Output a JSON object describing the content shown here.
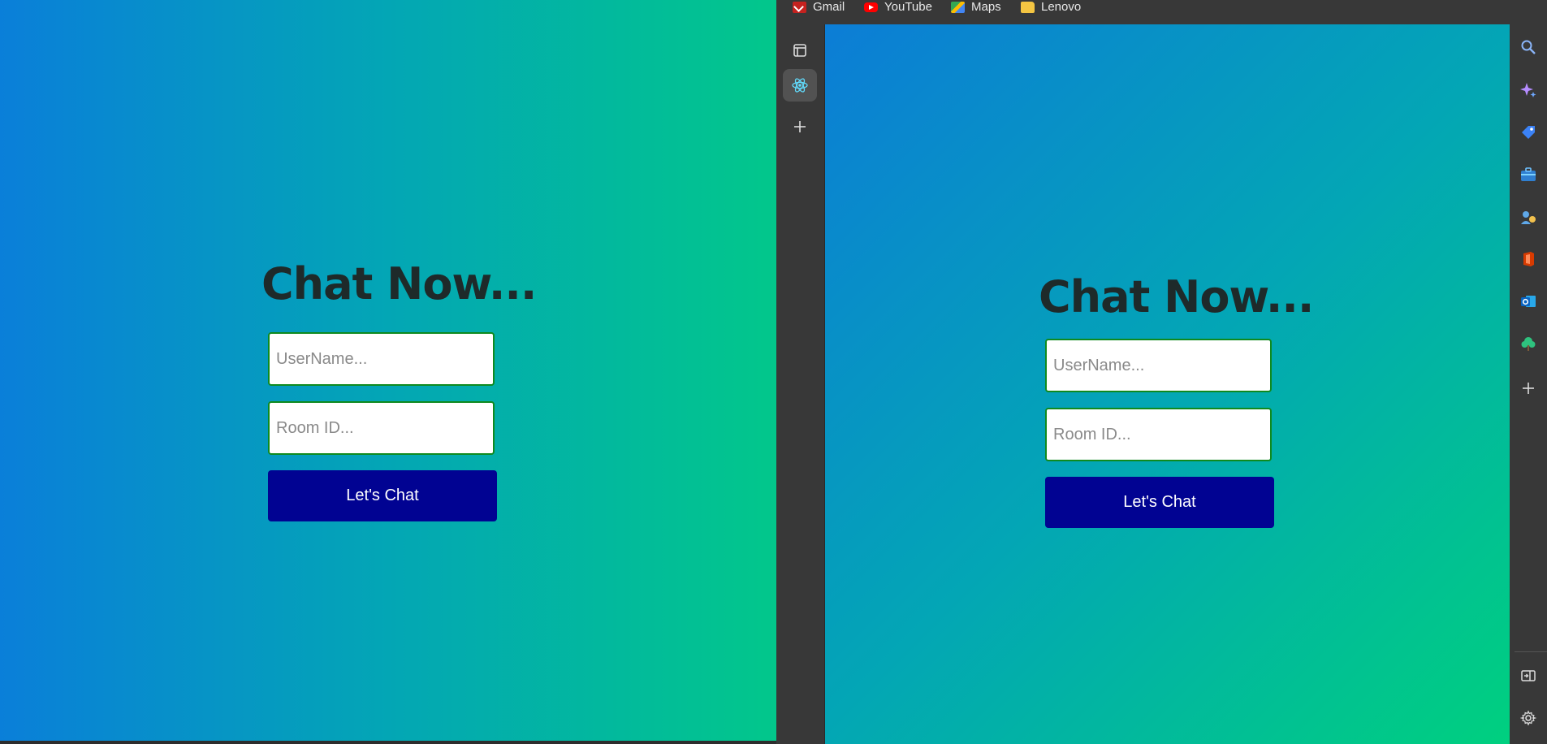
{
  "left_app": {
    "title": "Chat Now...",
    "username_placeholder": "UserName...",
    "room_placeholder": "Room ID...",
    "button_label": "Let's Chat"
  },
  "browser": {
    "bookmarks": [
      {
        "label": "Gmail",
        "icon": "gmail-icon"
      },
      {
        "label": "YouTube",
        "icon": "youtube-icon"
      },
      {
        "label": "Maps",
        "icon": "maps-icon"
      },
      {
        "label": "Lenovo",
        "icon": "folder-icon"
      }
    ],
    "tab_strip": [
      {
        "icon": "sidebar-toggle-icon"
      },
      {
        "icon": "react-app-icon",
        "active": true
      },
      {
        "icon": "new-tab-plus-icon"
      }
    ],
    "right_rail": [
      {
        "icon": "search-icon"
      },
      {
        "icon": "copilot-sparkle-icon"
      },
      {
        "icon": "shopping-tag-icon"
      },
      {
        "icon": "tools-briefcase-icon"
      },
      {
        "icon": "games-icon"
      },
      {
        "icon": "office-icon"
      },
      {
        "icon": "outlook-icon"
      },
      {
        "icon": "tree-icon"
      },
      {
        "icon": "add-icon"
      },
      {
        "icon": "split-screen-icon"
      },
      {
        "icon": "settings-gear-icon"
      }
    ]
  },
  "viewport_app": {
    "title": "Chat Now...",
    "username_placeholder": "UserName...",
    "room_placeholder": "Room ID...",
    "button_label": "Let's Chat"
  },
  "colors": {
    "gradient_start": "#0a7fd9",
    "gradient_end": "#02c78b",
    "input_border": "#0f8a1f",
    "button_bg": "#010392",
    "title_text": "#1e2a2a"
  }
}
